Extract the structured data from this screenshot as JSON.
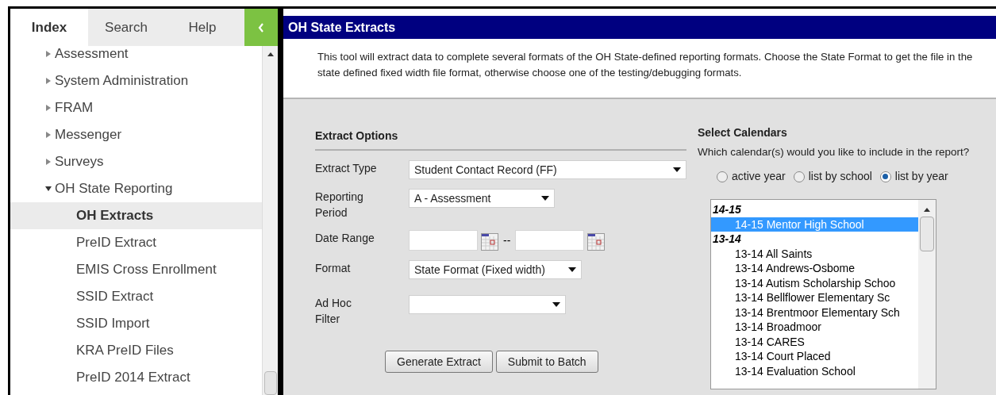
{
  "sidebar": {
    "tabs": [
      {
        "label": "Index",
        "selected": true
      },
      {
        "label": "Search",
        "selected": false
      },
      {
        "label": "Help",
        "selected": false
      }
    ],
    "tree": [
      {
        "label": "Assessment",
        "expanded": false,
        "selected": false
      },
      {
        "label": "System Administration",
        "expanded": false,
        "selected": false
      },
      {
        "label": "FRAM",
        "expanded": false,
        "selected": false
      },
      {
        "label": "Messenger",
        "expanded": false,
        "selected": false
      },
      {
        "label": "Surveys",
        "expanded": false,
        "selected": false
      },
      {
        "label": "OH State Reporting",
        "expanded": true,
        "selected": false,
        "children": [
          {
            "label": "OH Extracts",
            "selected": true
          },
          {
            "label": "PreID Extract",
            "selected": false
          },
          {
            "label": "EMIS Cross Enrollment",
            "selected": false
          },
          {
            "label": "SSID Extract",
            "selected": false
          },
          {
            "label": "SSID Import",
            "selected": false
          },
          {
            "label": "KRA PreID Files",
            "selected": false
          },
          {
            "label": "PreID 2014 Extract",
            "selected": false
          }
        ]
      }
    ]
  },
  "main": {
    "title": "OH State Extracts",
    "description": "This tool will extract data to complete several formats of the OH State-defined reporting formats. Choose the State Format to get the file in the state defined fixed width file format, otherwise choose one of the testing/debugging formats.",
    "extract_options": {
      "title": "Extract Options",
      "fields": [
        {
          "kind": "select",
          "label": "Extract Type",
          "value": "Student Contact Record (FF)"
        },
        {
          "kind": "select",
          "label": "Reporting Period",
          "value": "A - Assessment"
        },
        {
          "kind": "date_range",
          "label": "Date Range",
          "separator": "--"
        },
        {
          "kind": "select",
          "label": "Format",
          "value": "State Format (Fixed width)"
        },
        {
          "kind": "select",
          "label": "Ad Hoc Filter"
        }
      ],
      "buttons": [
        "Generate Extract",
        "Submit to Batch"
      ]
    },
    "calendars": {
      "title": "Select Calendars",
      "prompt": "Which calendar(s) would you like to include in the report?",
      "options": [
        {
          "label": "active year",
          "selected": false
        },
        {
          "label": "list by school",
          "selected": false
        },
        {
          "label": "list by year",
          "selected": true
        }
      ],
      "list": [
        {
          "label": "14-15",
          "children": [
            {
              "label": "14-15 Mentor High School",
              "selected": true
            }
          ]
        },
        {
          "label": "13-14",
          "children": [
            {
              "label": "13-14 All Saints",
              "selected": false
            },
            {
              "label": "13-14 Andrews-Osbome",
              "selected": false
            },
            {
              "label": "13-14 Autism Scholarship Schoo",
              "selected": false
            },
            {
              "label": "13-14 Bellflower Elementary Sc",
              "selected": false
            },
            {
              "label": "13-14 Brentmoor Elementary Sch",
              "selected": false
            },
            {
              "label": "13-14 Broadmoor",
              "selected": false
            },
            {
              "label": "13-14 CARES",
              "selected": false
            },
            {
              "label": "13-14 Court Placed",
              "selected": false
            },
            {
              "label": "13-14 Evaluation School",
              "selected": false
            }
          ]
        }
      ]
    }
  }
}
